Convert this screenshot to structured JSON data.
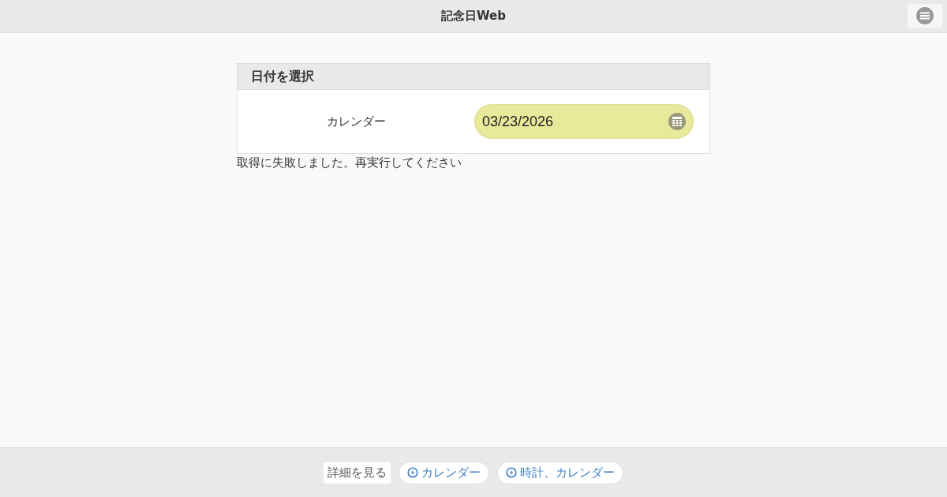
{
  "header": {
    "title": "記念日Web"
  },
  "panel": {
    "title": "日付を選択",
    "field_label": "カレンダー",
    "date_value": "03/23/2026"
  },
  "error_message": "取得に失敗しました。再実行してください",
  "footer": {
    "links": [
      {
        "label": "詳細を見る",
        "kind": "plain"
      },
      {
        "label": "カレンダー",
        "kind": "bolt"
      },
      {
        "label": "時計、カレンダー",
        "kind": "bolt"
      }
    ]
  }
}
